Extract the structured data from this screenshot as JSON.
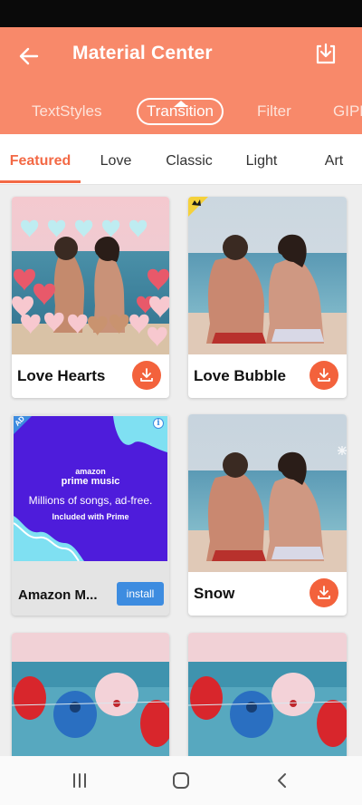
{
  "header": {
    "title": "Material Center",
    "back_icon": "arrow-left-icon",
    "download_icon": "download-tray-icon"
  },
  "tabs": [
    {
      "label": "TextStyles",
      "active": false
    },
    {
      "label": "Transition",
      "active": true
    },
    {
      "label": "Filter",
      "active": false
    },
    {
      "label": "GIPH",
      "active": false
    }
  ],
  "subtabs": [
    {
      "label": "Featured",
      "active": true
    },
    {
      "label": "Love",
      "active": false
    },
    {
      "label": "Classic",
      "active": false
    },
    {
      "label": "Light",
      "active": false
    },
    {
      "label": "Art",
      "active": false
    }
  ],
  "items": [
    {
      "label": "Love Hearts"
    },
    {
      "label": "Love Bubble"
    },
    {
      "label": "Snow"
    }
  ],
  "ad": {
    "badge": "AD",
    "info": "i",
    "brand_line1": "amazon",
    "brand_line2": "prime music",
    "headline": "Millions of songs, ad-free.",
    "subline": "Included with Prime",
    "title": "Amazon M...",
    "install": "install"
  },
  "colors": {
    "header": "#f8896a",
    "accent": "#f36945",
    "ad_blue": "#3d8ce0",
    "ad_purple": "#4e1cdb"
  }
}
